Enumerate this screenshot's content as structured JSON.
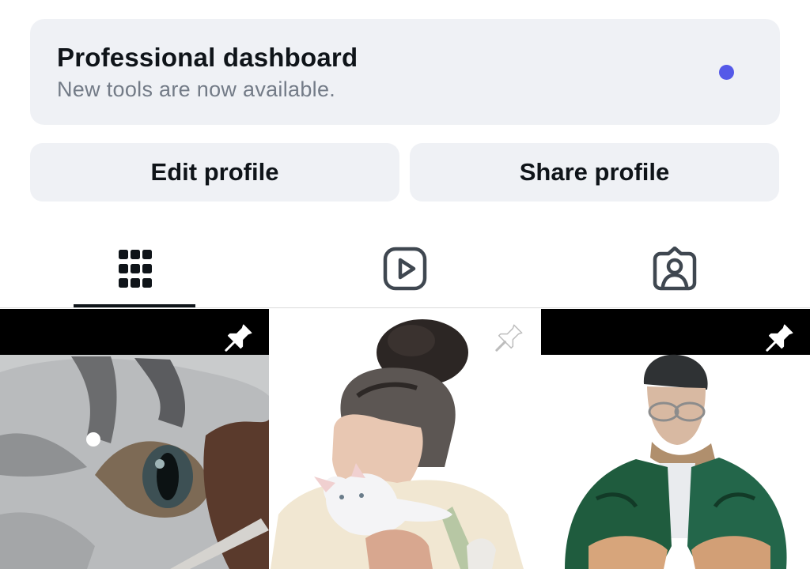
{
  "dashboard": {
    "title": "Professional dashboard",
    "subtitle": "New tools are now available.",
    "dot_color": "#5459e8"
  },
  "buttons": {
    "edit_label": "Edit profile",
    "share_label": "Share profile"
  },
  "tabs": [
    {
      "name": "posts-grid",
      "icon": "grid-icon",
      "active": true
    },
    {
      "name": "reels",
      "icon": "reels-icon",
      "active": false
    },
    {
      "name": "tagged",
      "icon": "tagged-icon",
      "active": false
    }
  ],
  "posts": [
    {
      "subject": "cat close-up drawing",
      "pinned": true
    },
    {
      "subject": "woman with bun hugging white cat drawing",
      "pinned": true
    },
    {
      "subject": "elderly man in green cardigan drawing",
      "pinned": true
    }
  ],
  "colors": {
    "card_bg": "#eff1f5",
    "text_primary": "#0f1419",
    "text_secondary": "#737b87",
    "accent_dot": "#5459e8"
  }
}
